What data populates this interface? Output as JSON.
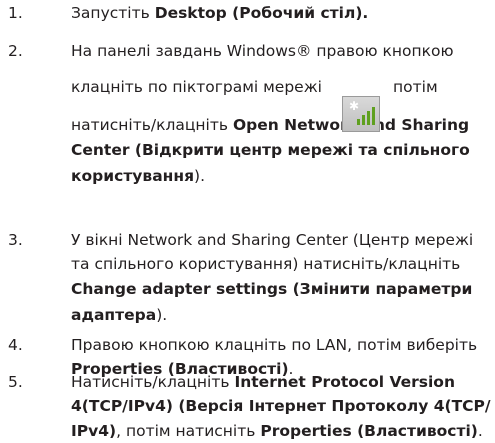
{
  "steps": [
    {
      "num": "1.",
      "lines": [
        {
          "runs": [
            {
              "t": "Запустіть ",
              "b": false
            },
            {
              "t": "Desktop (Робочий стіл).",
              "b": true
            }
          ]
        }
      ]
    },
    {
      "num": "2.",
      "lines": [
        {
          "runs": [
            {
              "t": "На панелі завдань Windows® правою кнопкою",
              "b": false
            }
          ]
        },
        {
          "runs": [
            {
              "t": "клацніть по піктограмі мережі",
              "b": false
            }
          ]
        },
        {
          "runs": [
            {
              "t": "натисніть/клацніть ",
              "b": false
            },
            {
              "t": "Open Network and Sharing",
              "b": true
            }
          ]
        },
        {
          "runs": [
            {
              "t": "Center (Відкрити центр мережі та спільного",
              "b": true
            }
          ]
        },
        {
          "runs": [
            {
              "t": "користування",
              "b": true
            },
            {
              "t": ").",
              "b": false
            }
          ]
        }
      ],
      "icon_after_text": "потім",
      "icon": "network-tray-icon"
    },
    {
      "num": "3.",
      "lines": [
        {
          "runs": [
            {
              "t": "У вікні Network and Sharing Center (Центр мережі",
              "b": false
            }
          ]
        },
        {
          "runs": [
            {
              "t": "та спільного користування) натисніть/клацніть",
              "b": false
            }
          ]
        },
        {
          "runs": [
            {
              "t": "Change adapter settings (Змінити параметри",
              "b": true
            }
          ]
        },
        {
          "runs": [
            {
              "t": "адаптера",
              "b": true
            },
            {
              "t": ").",
              "b": false
            }
          ]
        }
      ]
    },
    {
      "num": "4.",
      "lines": [
        {
          "runs": [
            {
              "t": "Правою кнопкою клацніть по LAN, потім виберіть",
              "b": false
            }
          ]
        },
        {
          "runs": [
            {
              "t": "Properties (Властивості)",
              "b": true
            },
            {
              "t": ".",
              "b": false
            }
          ]
        }
      ]
    },
    {
      "num": "5.",
      "lines": [
        {
          "runs": [
            {
              "t": "Натисніть/клацніть ",
              "b": false
            },
            {
              "t": "Internet Protocol Version",
              "b": true
            }
          ]
        },
        {
          "runs": [
            {
              "t": "4(TCP/IPv4) (Версія Інтернет Протоколу 4(TCP/",
              "b": true
            }
          ]
        },
        {
          "runs": [
            {
              "t": "IPv4)",
              "b": true
            },
            {
              "t": ", потім натисніть ",
              "b": false
            },
            {
              "t": "Properties (Властивості)",
              "b": true
            },
            {
              "t": ".",
              "b": false
            }
          ]
        }
      ]
    }
  ]
}
